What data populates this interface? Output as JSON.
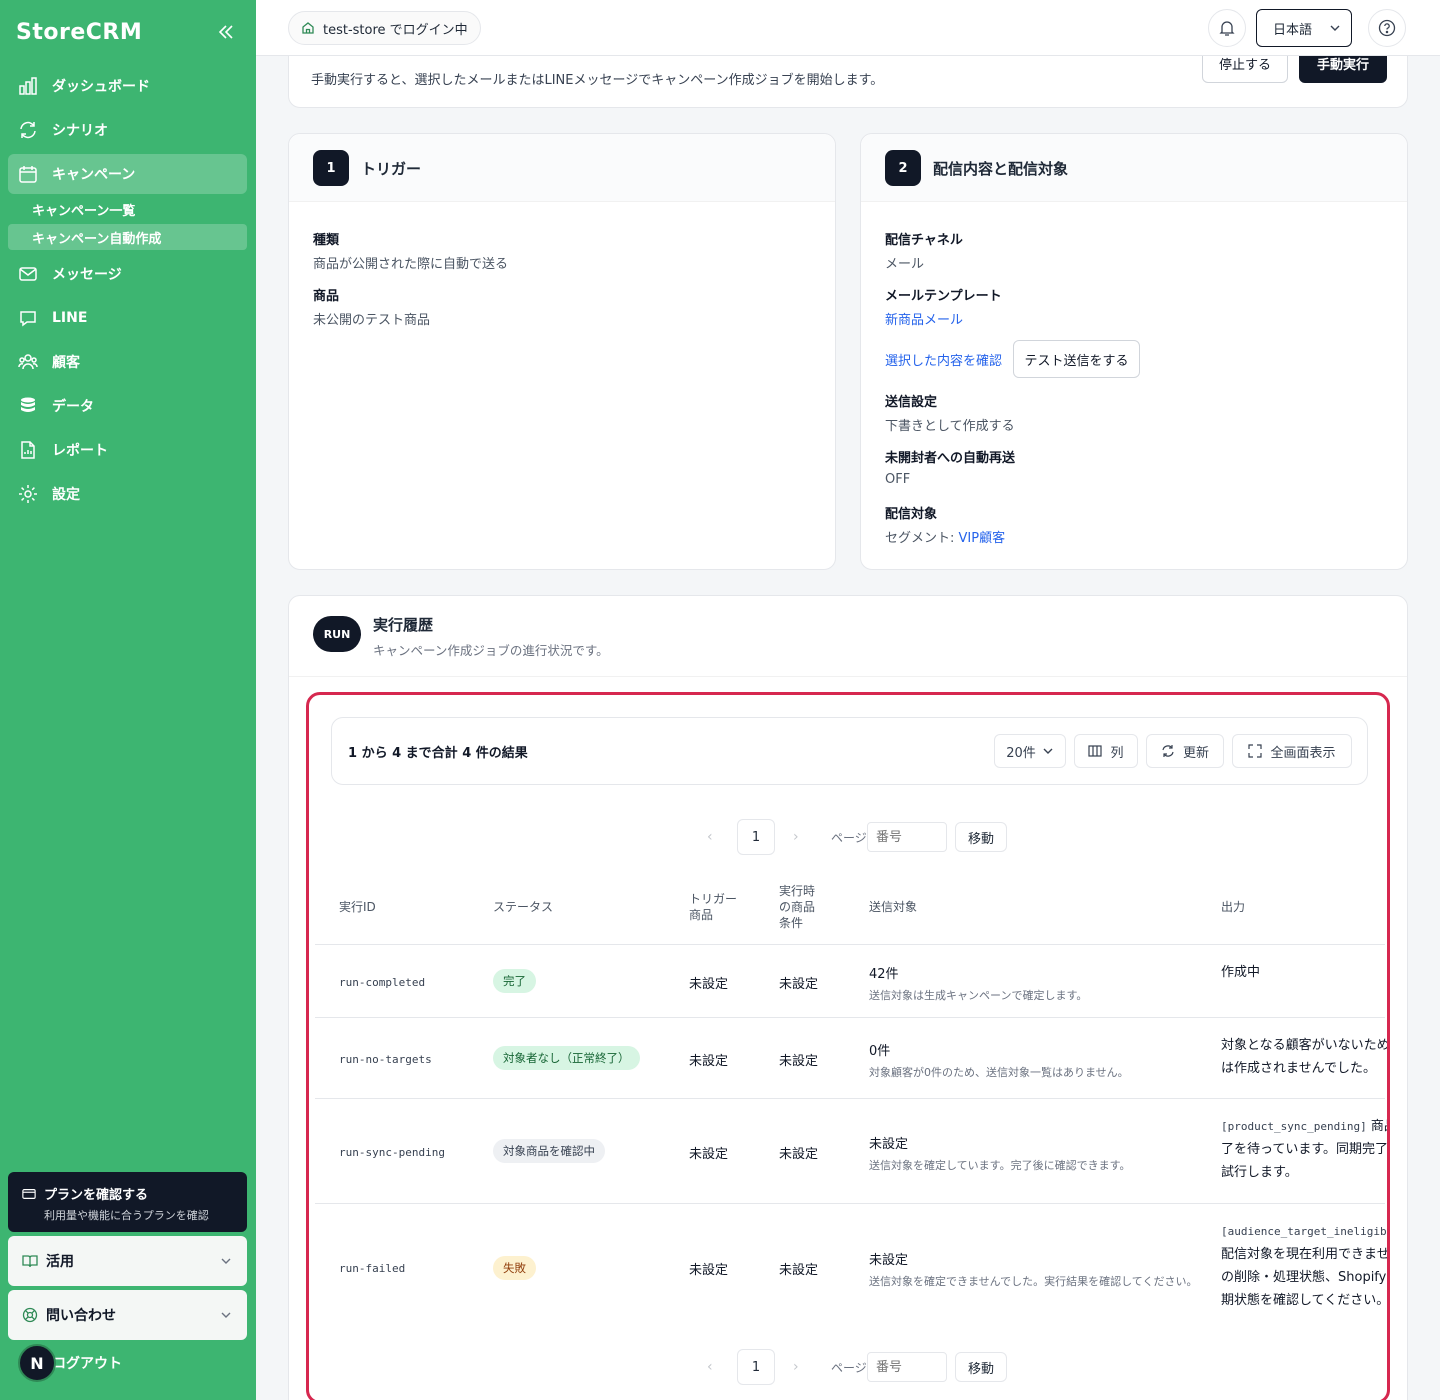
{
  "brand": "StoreCRM",
  "nav": {
    "dashboard": "ダッシュボード",
    "scenario": "シナリオ",
    "campaign": "キャンペーン",
    "campaign_list": "キャンペーン一覧",
    "campaign_auto": "キャンペーン自動作成",
    "message": "メッセージ",
    "line": "LINE",
    "customers": "顧客",
    "data": "データ",
    "report": "レポート",
    "settings": "設定"
  },
  "plan": {
    "title": "プランを確認する",
    "subtitle": "利用量や機能に合うプランを確認"
  },
  "usage": "活用",
  "contact": "問い合わせ",
  "logout": {
    "avatar": "N",
    "label": "ログアウト"
  },
  "topbar": {
    "store": "test-store でログイン中",
    "language": "日本語"
  },
  "top_card": {
    "description": "手動実行すると、選択したメールまたはLINEメッセージでキャンペーン作成ジョブを開始します。",
    "stop": "停止する",
    "run": "手動実行"
  },
  "trigger": {
    "num": "1",
    "title": "トリガー",
    "type_label": "種類",
    "type_value": "商品が公開された際に自動で送る",
    "product_label": "商品",
    "product_value": "未公開のテスト商品"
  },
  "delivery": {
    "num": "2",
    "title": "配信内容と配信対象",
    "channel_label": "配信チャネル",
    "channel_value": "メール",
    "template_label": "メールテンプレート",
    "template_value": "新商品メール",
    "confirm_link": "選択した内容を確認",
    "test_send": "テスト送信をする",
    "send_label": "送信設定",
    "send_value": "下書きとして作成する",
    "resend_label": "未開封者への自動再送",
    "resend_value": "OFF",
    "target_label": "配信対象",
    "target_prefix": "セグメント: ",
    "target_value": "VIP顧客"
  },
  "history": {
    "badge": "RUN",
    "title": "実行履歴",
    "subtitle": "キャンペーン作成ジョブの進行状況です。",
    "results": "1 から 4 まで合計 4 件の結果",
    "per_page": "20件",
    "columns_btn": "列",
    "refresh_btn": "更新",
    "fullscreen_btn": "全画面表示",
    "page": "1",
    "page_label": "ページ",
    "page_placeholder": "番号",
    "go": "移動",
    "prev": "‹",
    "next": "›",
    "headers": {
      "id": "実行ID",
      "status": "ステータス",
      "trigger_product_1": "トリガー",
      "trigger_product_2": "商品",
      "cond_1": "実行時",
      "cond_2": "の商品",
      "cond_3": "条件",
      "target": "送信対象",
      "output": "出力"
    },
    "rows": [
      {
        "id": "run-completed",
        "status": "完了",
        "trigger": "未設定",
        "cond": "未設定",
        "target": "42件",
        "target_note": "送信対象は生成キャンペーンで確定します。",
        "output_lines": [
          "作成中"
        ]
      },
      {
        "id": "run-no-targets",
        "status": "対象者なし（正常終了）",
        "trigger": "未設定",
        "cond": "未設定",
        "target": "0件",
        "target_note": "対象顧客が0件のため、送信対象一覧はありません。",
        "output_lines": [
          "対象となる顧客がいないため、",
          "は作成されませんでした。"
        ]
      },
      {
        "id": "run-sync-pending",
        "status": "対象商品を確認中",
        "trigger": "未設定",
        "cond": "未設定",
        "target": "未設定",
        "target_note": "送信対象を確定しています。完了後に確認できます。",
        "output_code": "[product_sync_pending]",
        "output_lines": [
          "商品",
          "了を待っています。同期完了後",
          "試行します。"
        ]
      },
      {
        "id": "run-failed",
        "status": "失敗",
        "trigger": "未設定",
        "cond": "未設定",
        "target": "未設定",
        "target_note": "送信対象を確定できませんでした。実行結果を確認してください。",
        "output_code": "[audience_target_ineligib",
        "output_lines": [
          "配信対象を現在利用できませ",
          "の削除・処理状態、Shopifyセ",
          "期状態を確認してください。"
        ]
      }
    ]
  }
}
